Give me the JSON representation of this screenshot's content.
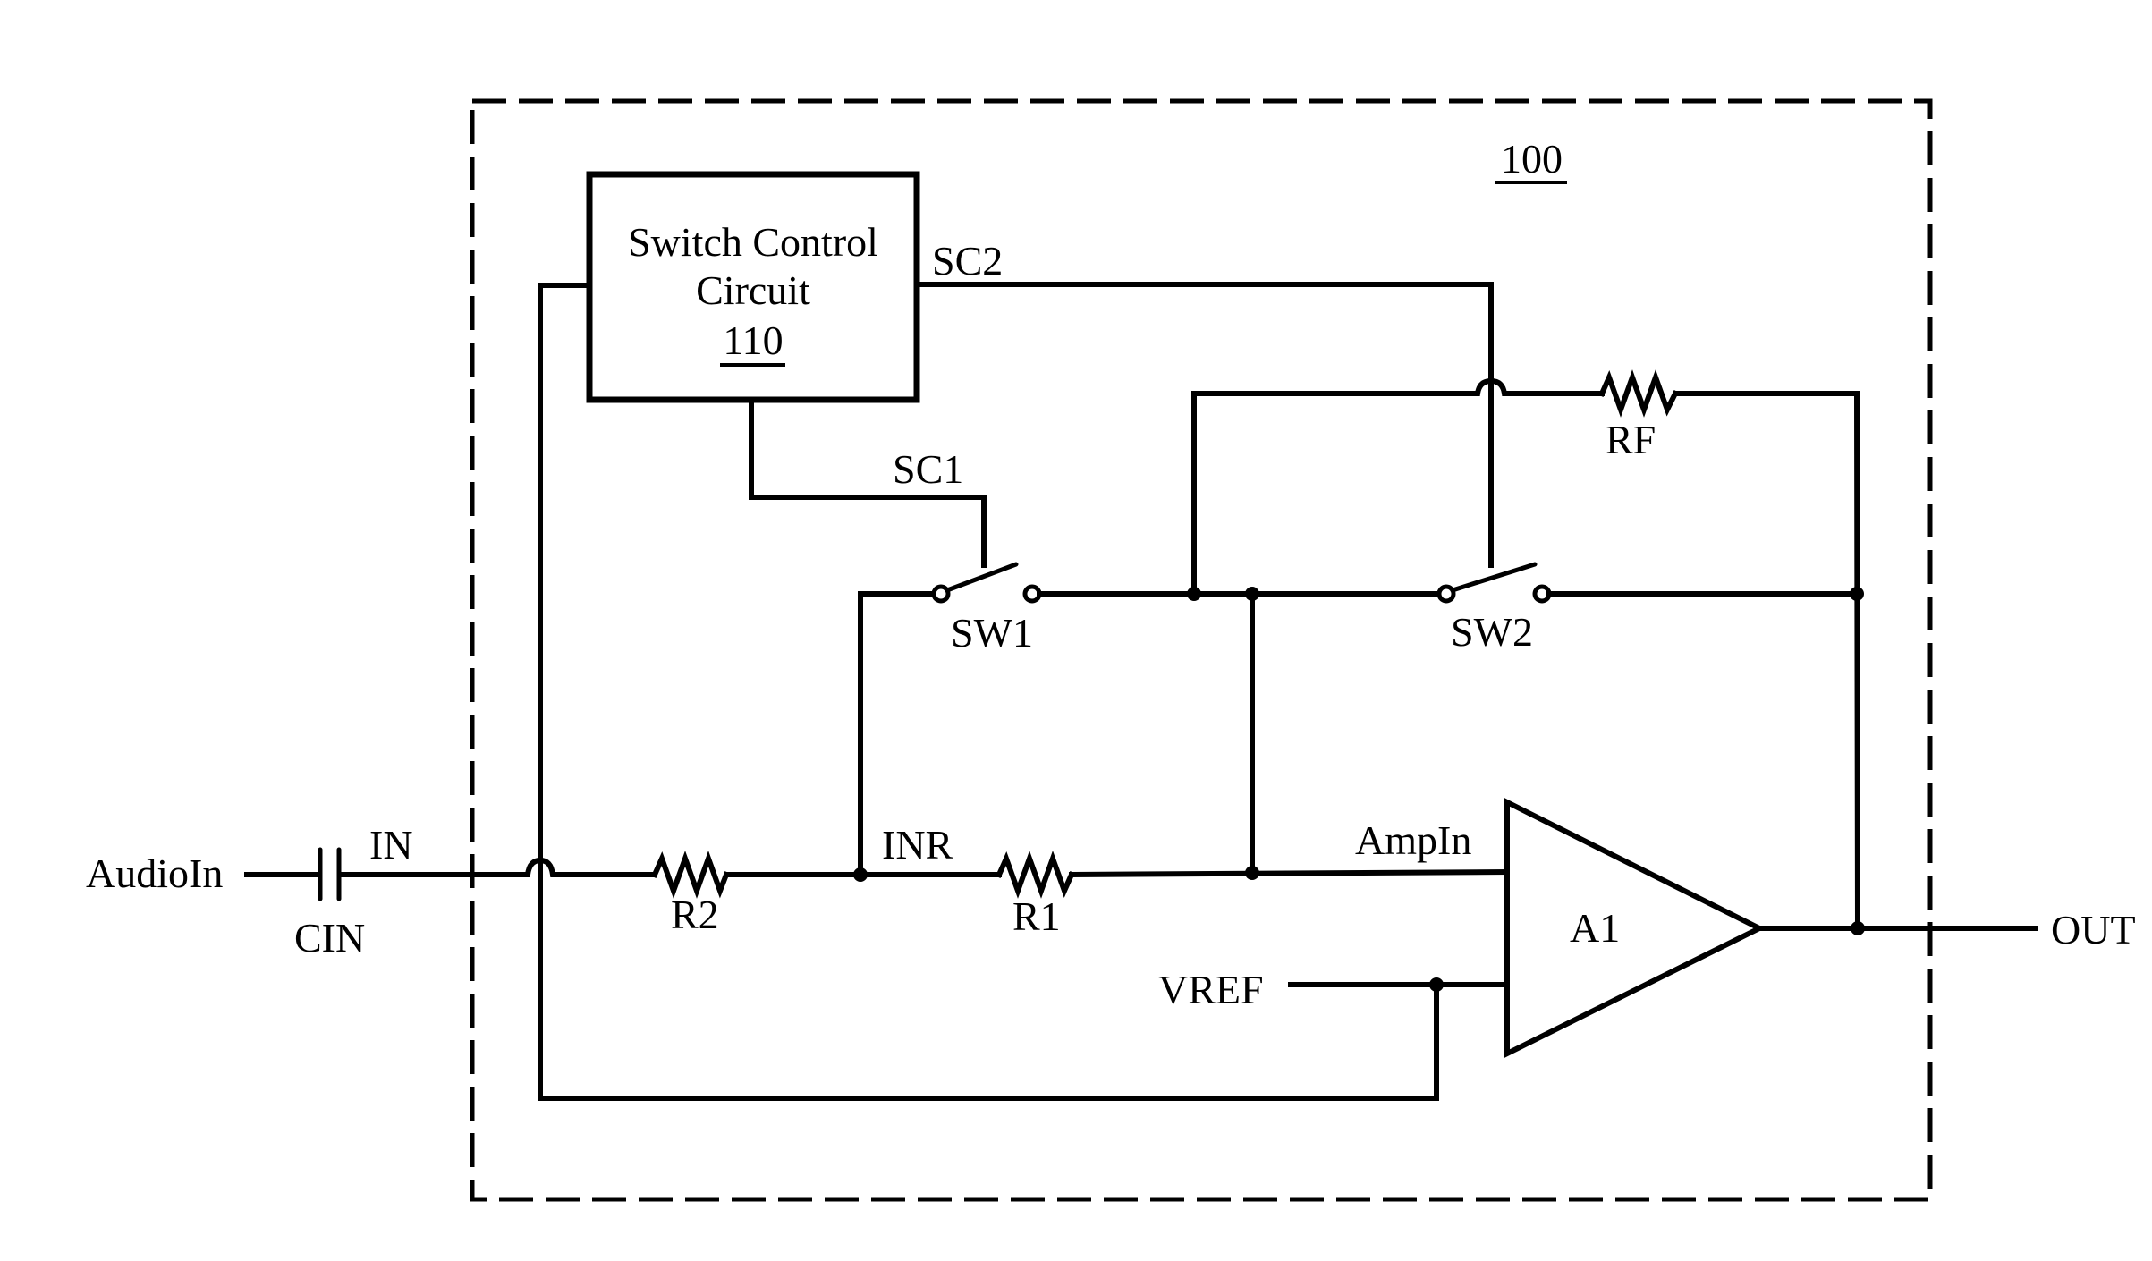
{
  "figure": {
    "module_ref": "100",
    "switch_control": {
      "line1": "Switch Control",
      "line2": "Circuit",
      "ref": "110"
    },
    "signals": {
      "sc1": "SC1",
      "sc2": "SC2",
      "in": "IN",
      "inr": "INR",
      "ampin": "AmpIn",
      "vref": "VREF",
      "audio_in": "AudioIn",
      "out": "OUT"
    },
    "components": {
      "cin": "CIN",
      "r1": "R1",
      "r2": "R2",
      "rf": "RF",
      "sw1": "SW1",
      "sw2": "SW2",
      "amp": "A1"
    }
  }
}
